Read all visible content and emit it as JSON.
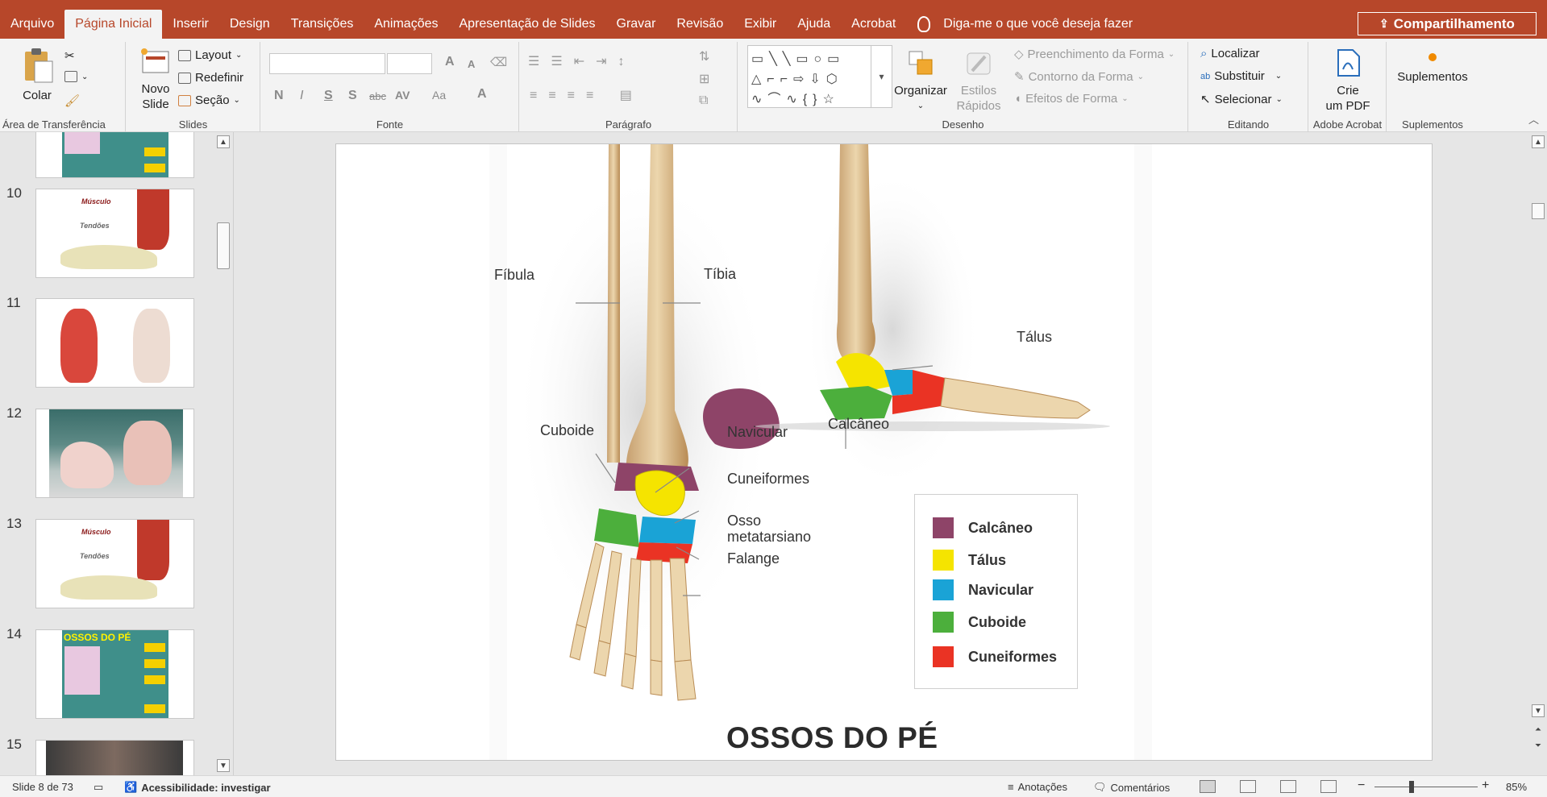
{
  "menu": {
    "items": [
      "Arquivo",
      "Página Inicial",
      "Inserir",
      "Design",
      "Transições",
      "Animações",
      "Apresentação de Slides",
      "Gravar",
      "Revisão",
      "Exibir",
      "Ajuda",
      "Acrobat"
    ],
    "tell_me": "Diga-me o que você deseja fazer",
    "share": "Compartilhamento"
  },
  "ribbon": {
    "clipboard": {
      "paste": "Colar",
      "label": "Área de Transferência"
    },
    "slides": {
      "new_slide_1": "Novo",
      "new_slide_2": "Slide",
      "layout": "Layout",
      "reset": "Redefinir",
      "section": "Seção",
      "label": "Slides"
    },
    "font": {
      "bold": "N",
      "italic": "I",
      "underline": "S",
      "shadow": "S",
      "strike": "abc",
      "spacing": "AV",
      "case": "Aa",
      "color": "A",
      "grow": "A",
      "shrink": "A",
      "label": "Fonte"
    },
    "paragraph": {
      "label": "Parágrafo"
    },
    "drawing": {
      "arrange": "Organizar",
      "quick_styles_1": "Estilos",
      "quick_styles_2": "Rápidos",
      "fill": "Preenchimento da Forma",
      "outline": "Contorno da Forma",
      "effects": "Efeitos de Forma",
      "label": "Desenho"
    },
    "editing": {
      "find": "Localizar",
      "replace": "Substituir",
      "select": "Selecionar",
      "label": "Editando"
    },
    "acrobat": {
      "create_1": "Crie",
      "create_2": "um PDF",
      "label": "Adobe Acrobat"
    },
    "addins": {
      "button": "Suplementos",
      "label": "Suplementos"
    }
  },
  "thumbnails": {
    "numbers": [
      "10",
      "11",
      "12",
      "13",
      "14",
      "15"
    ],
    "muscle": "Músculo",
    "tendons": "Tendões",
    "ossos_title": "OSSOS DO PÉ"
  },
  "slide": {
    "title": "OSSOS DO PÉ",
    "labels": {
      "fibula": "Fíbula",
      "tibia": "Tíbia",
      "talus": "Tálus",
      "calcaneus": "Calcâneo",
      "cuboid": "Cuboide",
      "navicular": "Navicular",
      "cuneiform": "Cuneiformes",
      "metatarsal_1": "Osso",
      "metatarsal_2": "metatarsiano",
      "phalanx": "Falange"
    },
    "legend": [
      {
        "label": "Calcâneo",
        "color": "#8e4468"
      },
      {
        "label": "Tálus",
        "color": "#f5e400"
      },
      {
        "label": "Navicular",
        "color": "#1aa3d6"
      },
      {
        "label": "Cuboide",
        "color": "#4caf3c"
      },
      {
        "label": "Cuneiformes",
        "color": "#ea3324"
      }
    ]
  },
  "status": {
    "slide_counter": "Slide 8 de 73",
    "accessibility": "Acessibilidade: investigar",
    "notes": "Anotações",
    "comments": "Comentários",
    "zoom": "85%"
  },
  "colors": {
    "accent": "#b7472a",
    "ribbon_bg": "#f3f3f3"
  }
}
